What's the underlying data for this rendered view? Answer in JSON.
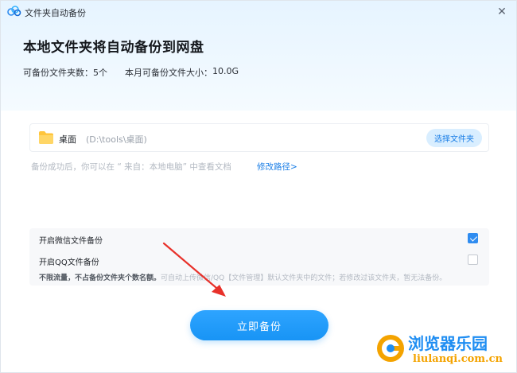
{
  "window": {
    "title": "文件夹自动备份",
    "close_icon": "✕"
  },
  "hero": {
    "headline": "本地文件夹将自动备份到网盘",
    "folder_count_label": "可备份文件夹数：",
    "folder_count_value": "5个",
    "size_label": "本月可备份文件大小：",
    "size_value": "10.0G"
  },
  "folder": {
    "name": "桌面",
    "path": "(D:\\tools\\桌面)",
    "choose_label": "选择文件夹"
  },
  "hint": {
    "text": "备份成功后，你可以在 “ 来自：本地电脑” 中查看文档",
    "link": "修改路径>"
  },
  "options": {
    "wechat_label": "开启微信文件备份",
    "wechat_checked": true,
    "qq_label": "开启QQ文件备份",
    "qq_checked": false,
    "desc_bold": "不限流量，不占备份文件夹个数名额。",
    "desc_rest": "可自动上传微信/QQ【文件管理】默认文件夹中的文件；若修改过该文件夹，暂无法备份。"
  },
  "actions": {
    "backup_label": "立即备份"
  },
  "watermark": {
    "brand": "浏览器乐园",
    "url": "liulanqi.com.cn"
  },
  "colors": {
    "accent": "#1894f5",
    "link": "#1a7ee6",
    "arrow": "#e8312a",
    "watermark_blue": "#1e8df2",
    "watermark_orange": "#f4a300"
  },
  "icons": {
    "app": "cloud-logo-icon",
    "folder": "folder-icon",
    "close": "close-icon",
    "check": "check-icon"
  }
}
